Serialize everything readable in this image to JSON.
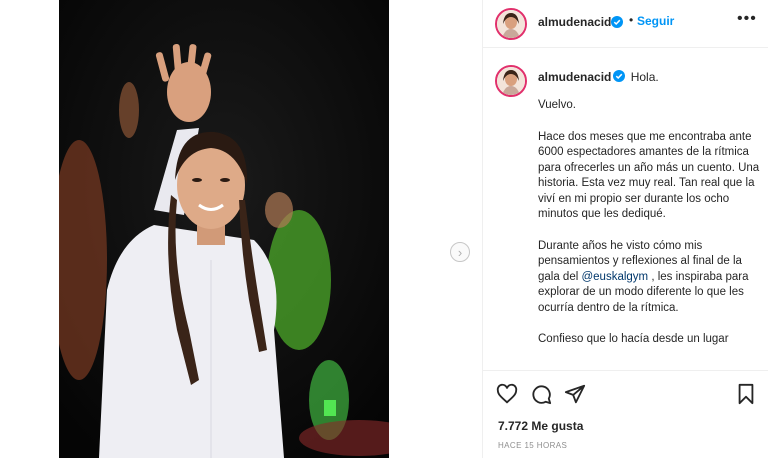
{
  "post": {
    "username": "almudenacid",
    "follow_label": "Seguir",
    "separator": "•",
    "more_icon": "more-options-icon"
  },
  "caption": {
    "username": "almudenacid",
    "first_line": "Hola.",
    "paragraphs": [
      "Vuelvo.",
      "Hace dos meses que me encontraba ante 6000 espectadores amantes de la rítmica para ofrecerles un año más un cuento. Una historia. Esta vez muy real. Tan real que la viví en mi propio ser durante los ocho minutos que les dediqué.",
      "Confieso que lo hacía desde un lugar"
    ],
    "p3_before": "Durante años he visto cómo mis pensamientos y reflexiones al final de la gala del ",
    "p3_mention": "@euskalgym",
    "p3_after": " , les inspiraba para explorar de un modo diferente lo que les ocurría dentro de la rítmica."
  },
  "footer": {
    "likes": "7.772 Me gusta",
    "time": "HACE 15 HORAS"
  },
  "colors": {
    "accent": "#0095f6",
    "mention": "#00376b",
    "border": "#efefef",
    "muted": "#8e8e8e"
  },
  "icons": [
    "heart-icon",
    "comment-icon",
    "share-icon",
    "bookmark-icon",
    "verified-badge-icon",
    "chevron-right-icon"
  ]
}
